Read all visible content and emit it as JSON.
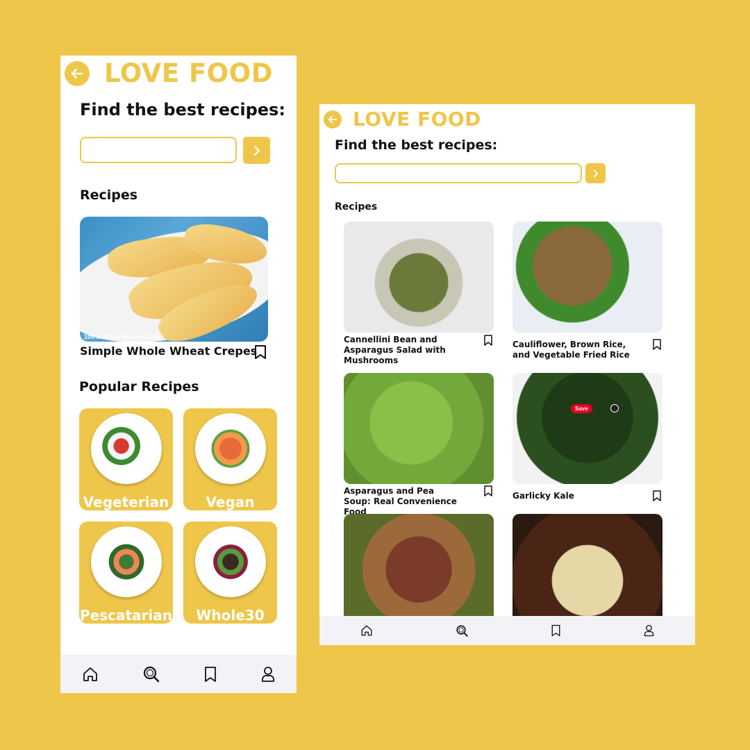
{
  "colors": {
    "background": "#EEC649",
    "accent": "#EEC649",
    "white": "#FFFFFF"
  },
  "phone_a": {
    "brand": "LOVE FOOD",
    "headline": "Find the best recipes:",
    "search": {
      "value": ""
    },
    "recipes_title": "Recipes",
    "featured": {
      "title": "Simple Whole Wheat Crepes",
      "image_caption": "100% Whole Wheat Crepes"
    },
    "popular_title": "Popular Recipes",
    "categories": [
      {
        "label": "Vegeterian"
      },
      {
        "label": "Vegan"
      },
      {
        "label": "Pescatarian"
      },
      {
        "label": "Whole30"
      }
    ],
    "tabs": [
      "home-icon",
      "search-icon",
      "bookmark-icon",
      "profile-icon"
    ]
  },
  "phone_b": {
    "brand": "LOVE FOOD",
    "headline": "Find the best recipes:",
    "search": {
      "value": ""
    },
    "recipes_title": "Recipes",
    "cards": [
      {
        "title": "Cannellini Bean and Asparagus Salad with Mushrooms"
      },
      {
        "title": "Cauliflower, Brown Rice, and Vegetable Fried Rice"
      },
      {
        "title": "Asparagus and Pea Soup: Real Convenience Food"
      },
      {
        "title": "Garlicky Kale",
        "save_label": "Save"
      },
      {
        "title": ""
      },
      {
        "title": ""
      }
    ],
    "tabs": [
      "home-icon",
      "search-icon",
      "bookmark-icon",
      "profile-icon"
    ]
  }
}
